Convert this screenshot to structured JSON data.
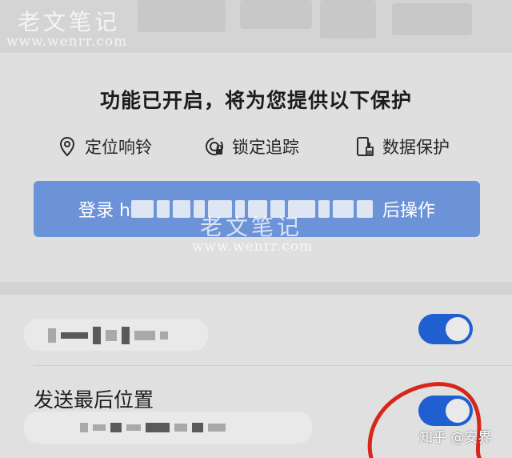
{
  "watermarks": {
    "brand": "老文笔记",
    "domain": "www.wenrr.com"
  },
  "protection": {
    "headline": "功能已开启，将为您提供以下保护",
    "features": [
      {
        "label": "定位响铃",
        "icon": "location-pin-icon"
      },
      {
        "label": "锁定追踪",
        "icon": "lock-radar-icon"
      },
      {
        "label": "数据保护",
        "icon": "phone-broom-icon"
      }
    ],
    "login_prefix": "登录 htt",
    "login_suffix": "后操作"
  },
  "settings": {
    "row1": {
      "toggle_on": true
    },
    "row2": {
      "title": "发送最后位置",
      "toggle_on": true
    }
  },
  "credit": "知乎 @安界",
  "colors": {
    "accent_button": "#6c93d8",
    "toggle_on": "#1f5fd0",
    "annotation_red": "#d8261b"
  }
}
